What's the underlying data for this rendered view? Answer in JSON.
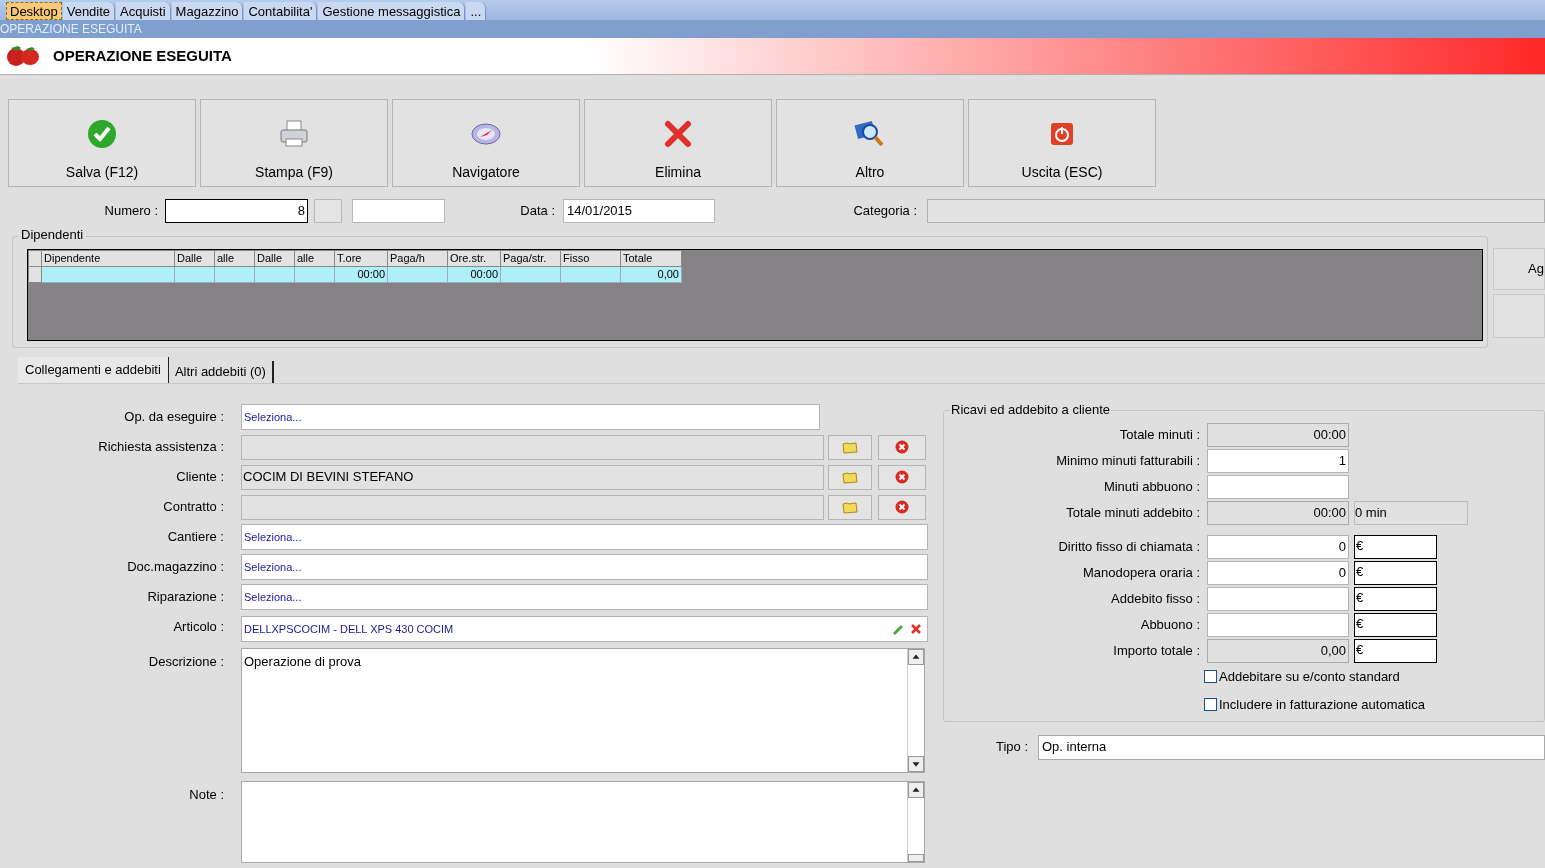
{
  "menu_tabs": [
    {
      "label": "Desktop",
      "selected": true
    },
    {
      "label": "Vendite",
      "selected": false
    },
    {
      "label": "Acquisti",
      "selected": false
    },
    {
      "label": "Magazzino",
      "selected": false
    },
    {
      "label": "Contabilita'",
      "selected": false
    },
    {
      "label": "Gestione messaggistica",
      "selected": false
    },
    {
      "label": "...",
      "selected": false
    }
  ],
  "window_title": "OPERAZIONE ESEGUITA",
  "header_title": "OPERAZIONE ESEGUITA",
  "toolbar": [
    {
      "label": "Salva (F12)",
      "kind": "check"
    },
    {
      "label": "Stampa (F9)",
      "kind": "printer"
    },
    {
      "label": "Navigatore",
      "kind": "compass"
    },
    {
      "label": "Elimina",
      "kind": "cross"
    },
    {
      "label": "Altro",
      "kind": "magnifier"
    },
    {
      "label": "Uscita (ESC)",
      "kind": "power"
    }
  ],
  "numero": {
    "label": "Numero :",
    "value": "8"
  },
  "data": {
    "label": "Data :",
    "value": "14/01/2015"
  },
  "categoria": {
    "label": "Categoria :"
  },
  "dipendenti": {
    "title": "Dipendenti",
    "columns": [
      "Dipendente",
      "Dalle",
      "alle",
      "Dalle",
      "alle",
      "T.ore",
      "Paga/h",
      "Ore.str.",
      "Paga/str.",
      "Fisso",
      "Totale"
    ],
    "rows": [
      [
        "",
        "",
        "",
        "",
        "",
        "00:00",
        "",
        "00:00",
        "",
        "",
        "0,00"
      ]
    ],
    "side_button": "Ag"
  },
  "detail_tabs": [
    {
      "label": "Collegamenti e addebiti",
      "selected": true
    },
    {
      "label": "Altri addebiti (0)",
      "selected": false
    }
  ],
  "links": [
    {
      "label": "Op. da eseguire :",
      "value": "Seleziona...",
      "kind": "select"
    },
    {
      "label": "Richiesta assistenza :",
      "kind": "lookup"
    },
    {
      "label": "Cliente :",
      "value": "COCIM DI BEVINI STEFANO",
      "kind": "lookup"
    },
    {
      "label": "Contratto :",
      "kind": "lookup"
    },
    {
      "label": "Cantiere :",
      "value": "Seleziona...",
      "kind": "select_wide"
    },
    {
      "label": "Doc.magazzino :",
      "value": "Seleziona...",
      "kind": "select_wide"
    },
    {
      "label": "Riparazione :",
      "value": "Seleziona...",
      "kind": "select_wide"
    },
    {
      "label": "Articolo :",
      "value": "DELLXPSCOCIM - DELL XPS 430 COCIM",
      "kind": "article"
    }
  ],
  "descrizione": {
    "label": "Descrizione :",
    "value": "Operazione di prova"
  },
  "note": {
    "label": "Note :"
  },
  "ricavi": {
    "title": "Ricavi ed addebito a cliente",
    "rows": [
      {
        "label": "Totale minuti :",
        "value": "00:00",
        "readonly": true,
        "kind": "plain"
      },
      {
        "label": "Minimo minuti fatturabili :",
        "value": "1",
        "readonly": false,
        "kind": "plain"
      },
      {
        "label": "Minuti abbuono :",
        "value": "",
        "readonly": false,
        "kind": "plain"
      },
      {
        "label": "Totale minuti addebito :",
        "value": "00:00",
        "readonly": true,
        "kind": "minutes",
        "extra": "0 min"
      },
      {
        "label": "Diritto fisso di chiamata :",
        "value": "0",
        "readonly": false,
        "kind": "euro",
        "extra": "€"
      },
      {
        "label": "Manodopera oraria :",
        "value": "0",
        "readonly": false,
        "kind": "euro",
        "extra": "€"
      },
      {
        "label": "Addebito fisso :",
        "value": "",
        "readonly": false,
        "kind": "euro",
        "extra": "€"
      },
      {
        "label": "Abbuono :",
        "value": "",
        "readonly": false,
        "kind": "euro",
        "extra": "€"
      },
      {
        "label": "Importo totale :",
        "value": "0,00",
        "readonly": true,
        "kind": "euro",
        "extra": "€"
      }
    ],
    "checkboxes": [
      {
        "label": "Addebitare su e/conto standard",
        "checked": false
      },
      {
        "label": "Includere in fatturazione automatica",
        "checked": false
      }
    ]
  },
  "tipo": {
    "label": "Tipo :",
    "value": "Op. interna"
  }
}
